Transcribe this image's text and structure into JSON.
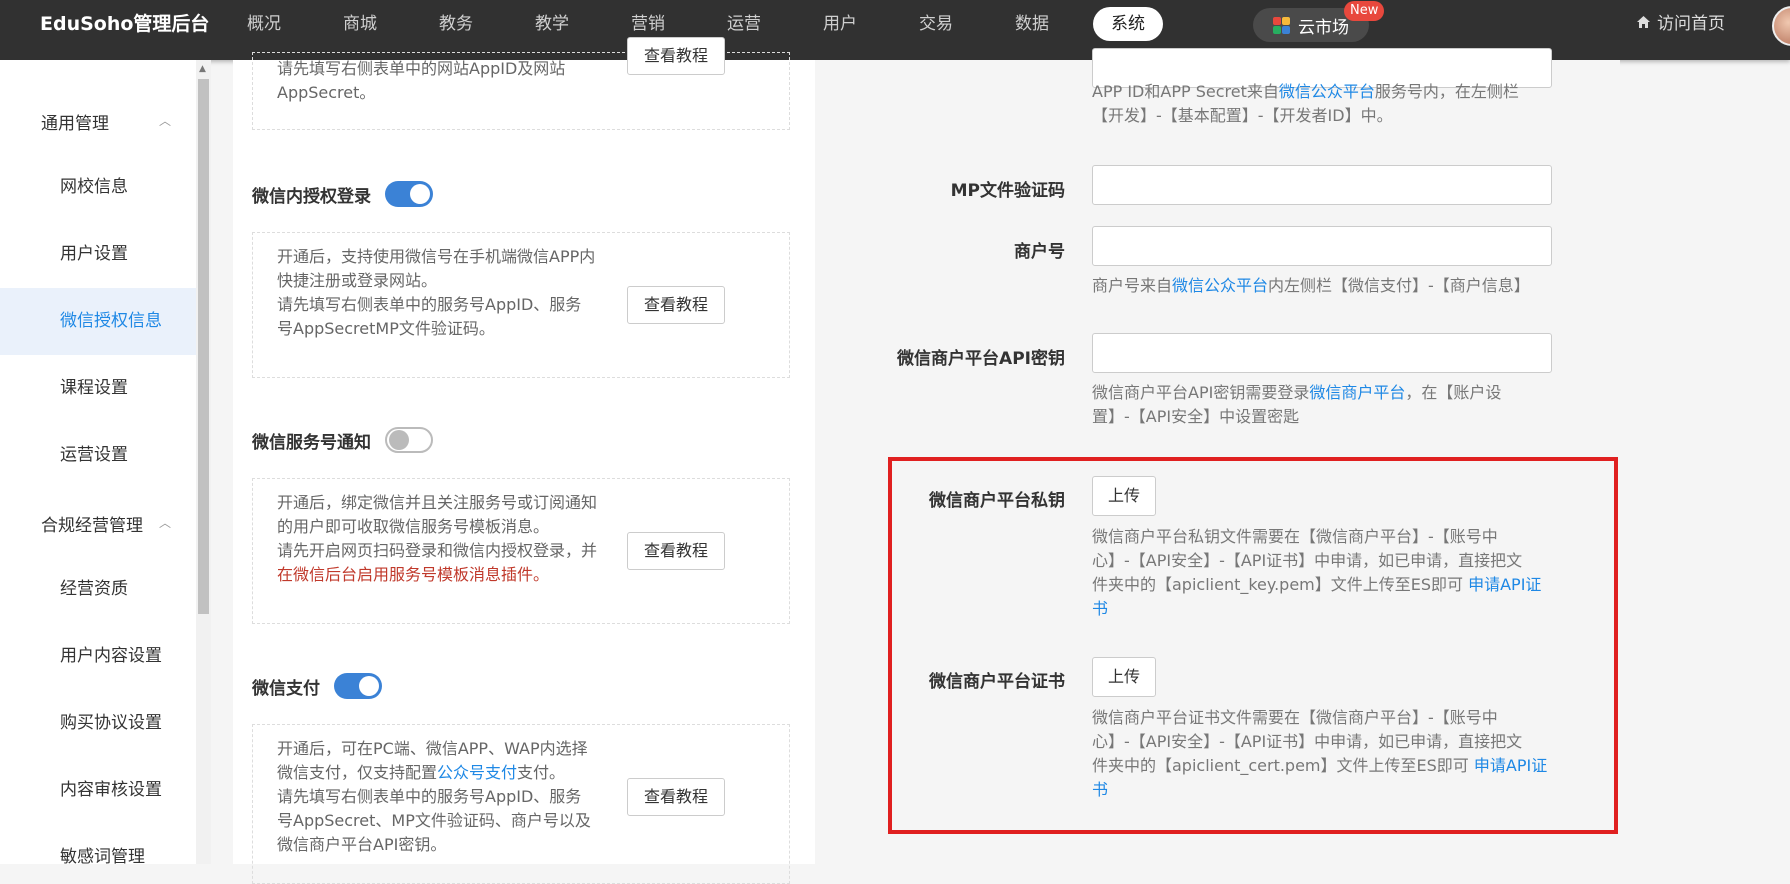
{
  "header": {
    "brand": "EduSoho管理后台",
    "nav": [
      {
        "label": "概况"
      },
      {
        "label": "商城"
      },
      {
        "label": "教务"
      },
      {
        "label": "教学"
      },
      {
        "label": "营销"
      },
      {
        "label": "运营"
      },
      {
        "label": "用户"
      },
      {
        "label": "交易"
      },
      {
        "label": "数据"
      },
      {
        "label": "系统"
      }
    ],
    "active_nav": "系统",
    "market_label": "云市场",
    "market_badge": "New",
    "home_link": "访问首页",
    "icons": [
      "grid-icon",
      "home-icon",
      "avatar"
    ]
  },
  "sidebar": {
    "group1": "通用管理",
    "items1": [
      {
        "label": "网校信息"
      },
      {
        "label": "用户设置"
      },
      {
        "label": "微信授权信息"
      },
      {
        "label": "课程设置"
      },
      {
        "label": "运营设置"
      }
    ],
    "group2": "合规经营管理",
    "items2": [
      {
        "label": "经营资质"
      },
      {
        "label": "用户内容设置"
      },
      {
        "label": "购买协议设置"
      },
      {
        "label": "内容审核设置"
      },
      {
        "label": "敏感词管理"
      }
    ],
    "active_item": "微信授权信息"
  },
  "left_panel": {
    "top_box": {
      "line1": "请先填写右侧表单中的网站AppID及网站",
      "line2": "AppSecret。",
      "button": "查看教程"
    },
    "wechat_login": {
      "title": "微信内授权登录",
      "enabled": true,
      "line1": "开通后，支持使用微信号在手机端微信APP内",
      "line2": "快捷注册或登录网站。",
      "line3": "请先填写右侧表单中的服务号AppID、服务",
      "line4": "号AppSecretMP文件验证码。",
      "button": "查看教程"
    },
    "service_notify": {
      "title": "微信服务号通知",
      "enabled": false,
      "line1": "开通后，绑定微信并且关注服务号或订阅通知",
      "line2": "的用户即可收取微信服务号模板消息。",
      "line3": "请先开启网页扫码登录和微信内授权登录，并",
      "line4_red": "在微信后台启用服务号模板消息插件。",
      "button": "查看教程"
    },
    "wechat_pay": {
      "title": "微信支付",
      "enabled": true,
      "line1": "开通后，可在PC端、微信APP、WAP内选择",
      "line2_pre": "微信支付，仅支持配置",
      "line2_link": "公众号支付",
      "line2_post": "支付。",
      "line3": "请先填写右侧表单中的服务号AppID、服务",
      "line4": "号AppSecret、MP文件验证码、商户号以及",
      "line5": "微信商户平台API密钥。",
      "button": "查看教程"
    }
  },
  "right_panel": {
    "app_help_pre": "APP ID和APP Secret来自",
    "app_help_link": "微信公众平台",
    "app_help_post": "服务号内，在左侧栏",
    "app_help_line2": "【开发】-【基本配置】-【开发者ID】中。",
    "mp_label": "MP文件验证码",
    "mp_value": "",
    "merchant_label": "商户号",
    "merchant_value": "",
    "merchant_help_pre": "商户号来自",
    "merchant_help_link": "微信公众平台",
    "merchant_help_post": "内左侧栏【微信支付】-【商户信息】",
    "apikey_label": "微信商户平台API密钥",
    "apikey_value": "",
    "apikey_help_pre": "微信商户平台API密钥需要登录",
    "apikey_help_link": "微信商户平台",
    "apikey_help_post": "，在【账户设",
    "apikey_help_line2": "置】-【API安全】中设置密匙",
    "privkey_label": "微信商户平台私钥",
    "privkey_button": "上传",
    "privkey_help_l1": "微信商户平台私钥文件需要在【微信商户平台】-【账号中",
    "privkey_help_l2": "心】-【API安全】-【API证书】中申请，如已申请，直接把文",
    "privkey_help_l3_pre": "件夹中的【apiclient_key.pem】文件上传至ES即可 ",
    "privkey_help_l3_link": "申请API证",
    "privkey_help_l4_link": "书",
    "cert_label": "微信商户平台证书",
    "cert_button": "上传",
    "cert_help_l1": "微信商户平台证书文件需要在【微信商户平台】-【账号中",
    "cert_help_l2": "心】-【API安全】-【API证书】中申请，如已申请，直接把文",
    "cert_help_l3_pre": "件夹中的【apiclient_cert.pem】文件上传至ES即可 ",
    "cert_help_l3_link": "申请API证",
    "cert_help_l4_link": "书"
  },
  "colors": {
    "accent": "#1e88e5",
    "highlight": "#e02020",
    "topbar": "#313131",
    "warning_text": "#c0392b"
  }
}
